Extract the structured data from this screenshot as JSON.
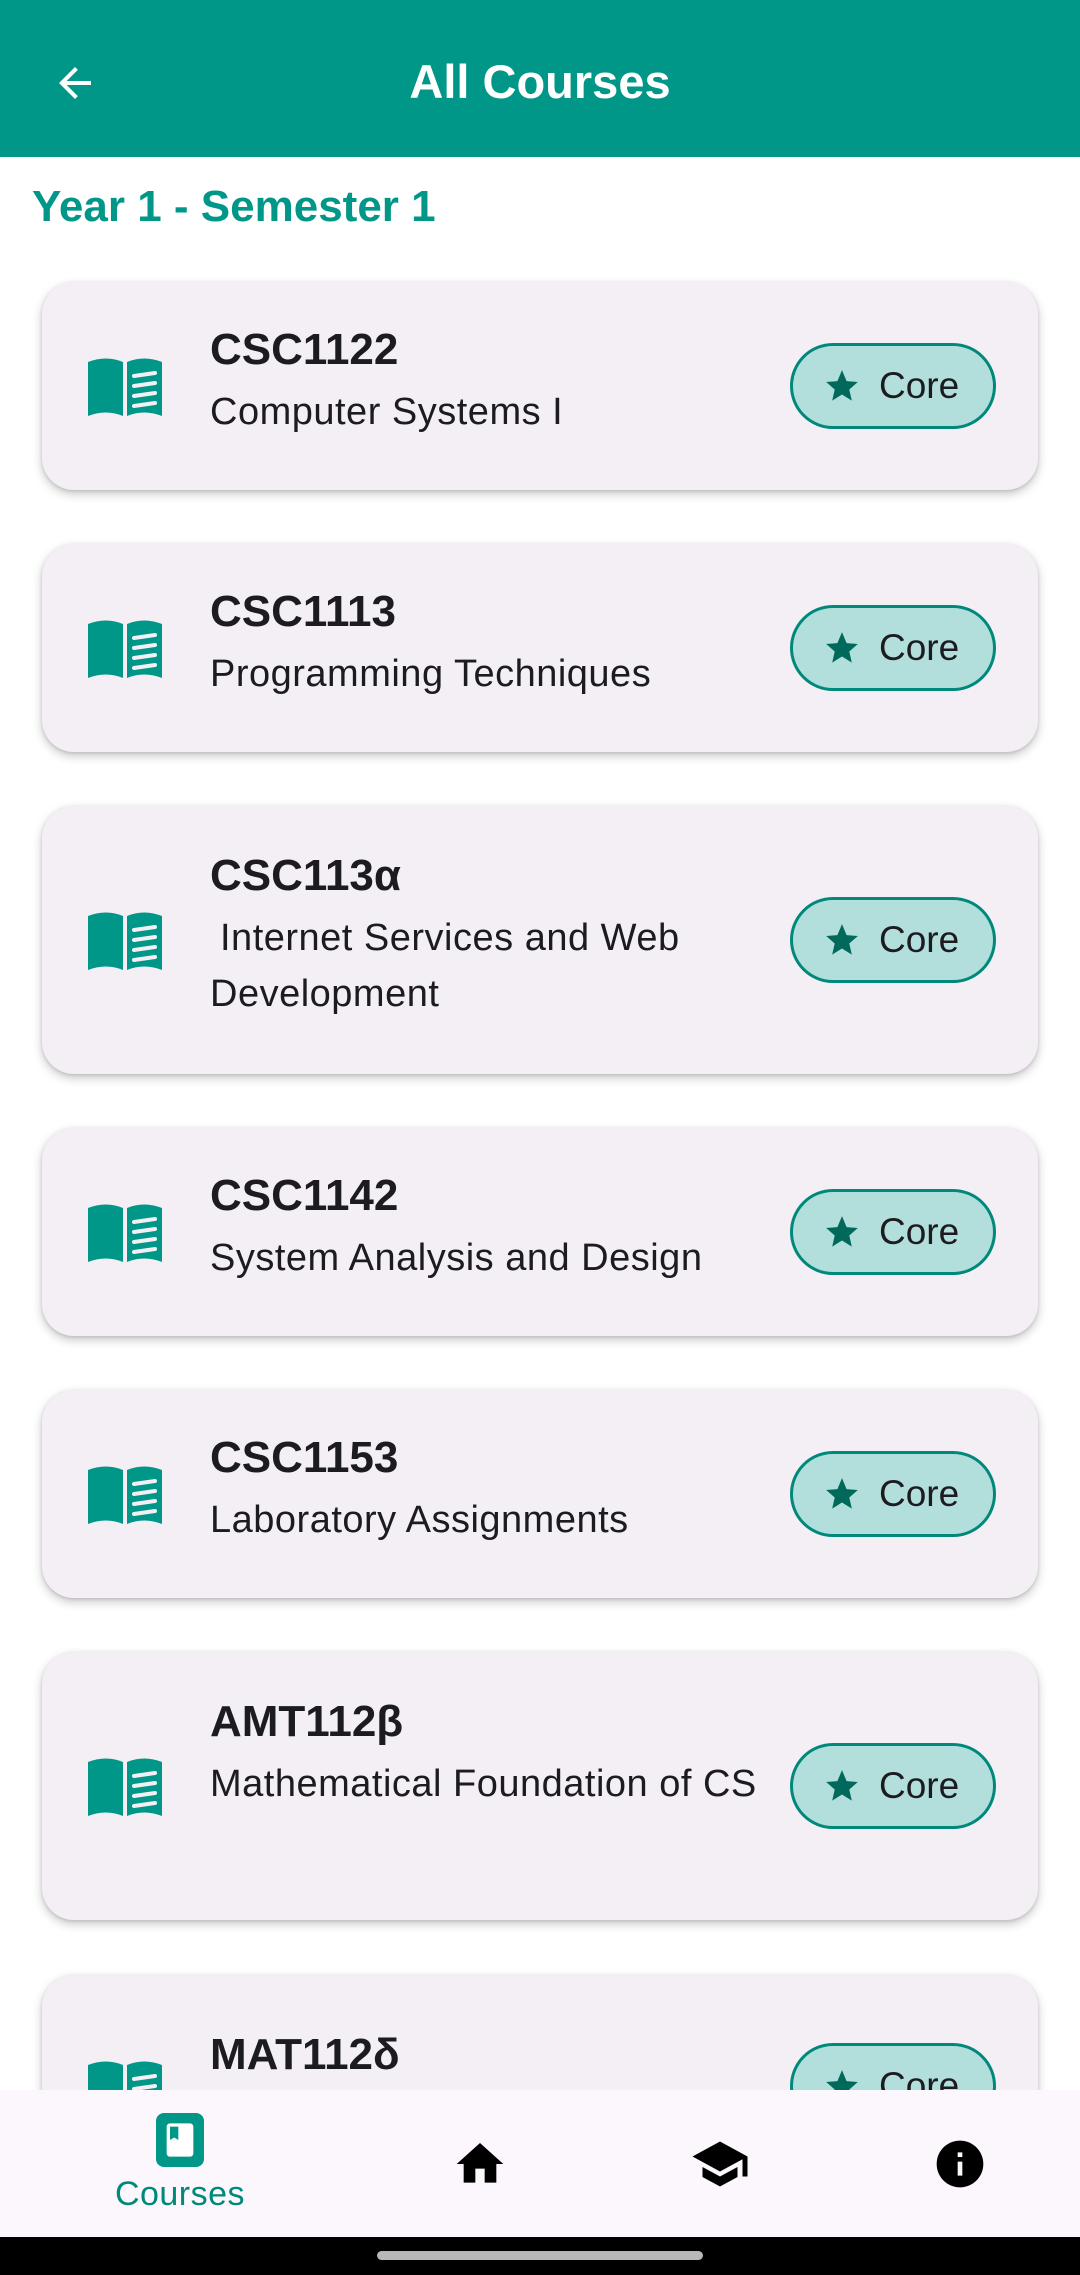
{
  "appbar": {
    "title": "All Courses",
    "back_icon": "arrow-left-icon"
  },
  "section": {
    "heading": "Year 1 - Semester 1"
  },
  "courses": [
    {
      "code": "CSC1122",
      "name": "Computer Systems I",
      "type": "Core"
    },
    {
      "code": "CSC1113",
      "name": "Programming Techniques",
      "type": "Core"
    },
    {
      "code": "CSC113α",
      "name": "Internet Services and Web Development",
      "type": "Core"
    },
    {
      "code": "CSC1142",
      "name": "System Analysis and Design",
      "type": "Core"
    },
    {
      "code": "CSC1153",
      "name": "Laboratory Assignments",
      "type": "Core"
    },
    {
      "code": "AMT112β",
      "name": "Mathematical Foundation of CS",
      "type": "Core"
    },
    {
      "code": "MAT112δ",
      "name": "",
      "type": "Core"
    }
  ],
  "bottom_nav": {
    "items": [
      {
        "label": "Courses",
        "icon": "book-icon",
        "active": true
      },
      {
        "label": "",
        "icon": "home-icon",
        "active": false
      },
      {
        "label": "",
        "icon": "graduation-cap-icon",
        "active": false
      },
      {
        "label": "",
        "icon": "info-icon",
        "active": false
      }
    ]
  },
  "colors": {
    "primary": "#009688",
    "chip_bg": "#b2dfdb",
    "chip_border": "#00897b",
    "card_bg": "#f3eff5",
    "star": "#00695c"
  }
}
